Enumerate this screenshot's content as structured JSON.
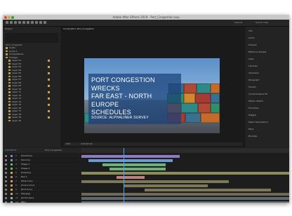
{
  "window": {
    "title": "Adobe After Effects 2019 - Port_Congestion.aep"
  },
  "toolbar": {
    "workspace_label": "Default",
    "search_label": "Search Help"
  },
  "project_panel": {
    "tab_label": "Project",
    "comp_name": "Port_Congestion",
    "items": [
      "Solids",
      "Comp 1",
      "Compositions",
      "Footage",
      "Layer 01",
      "Layer 02",
      "Layer 03",
      "Layer 04",
      "Layer 05",
      "Layer 06",
      "Layer 07",
      "Layer 08",
      "Layer 09",
      "Layer 10",
      "Layer 11",
      "Layer 12",
      "Layer 13",
      "Layer 14",
      "Layer 15",
      "Layer 16",
      "Layer 17",
      "Layer 18",
      "Layer 19",
      "Layer 20"
    ]
  },
  "composition": {
    "tab_label": "Composition Port_Congestion",
    "headline_line1": "PORT CONGESTION WRECKS",
    "headline_line2": "FAR EAST - NORTH EUROPE",
    "headline_line3": "SCHEDULES",
    "source": "SOURCE: ALPHALINER SURVEY",
    "zoom": "50%",
    "timecode": "0:00:04:12"
  },
  "right_panel": {
    "items": [
      "Info",
      "Audio",
      "Preview",
      "Effects & Presets",
      "Align",
      "Libraries",
      "Character",
      "Paragraph",
      "Tracker",
      "Content-Aware Fill",
      "Motion Sketch",
      "Smoother",
      "Wiggler",
      "Mask Interpolation",
      "Paint",
      "Brushes"
    ]
  },
  "timeline": {
    "tab_label": "Port_Congestion",
    "layers": [
      {
        "num": "1",
        "name": "[Headline]",
        "color": "#8f7bbd"
      },
      {
        "num": "2",
        "name": "[Source]",
        "color": "#6c9bd1"
      },
      {
        "num": "3",
        "name": "Shape 1",
        "color": "#6fb07a"
      },
      {
        "num": "4",
        "name": "Shape 2",
        "color": "#6fb07a"
      },
      {
        "num": "5",
        "name": "[Overlay]",
        "color": "#c8a34d"
      },
      {
        "num": "6",
        "name": "Null 1",
        "color": "#c17f7f"
      },
      {
        "num": "7",
        "name": "[Ship.mov]",
        "color": "#c8a34d"
      },
      {
        "num": "8",
        "name": "[Crane.mov]",
        "color": "#c8a34d"
      },
      {
        "num": "9",
        "name": "[Port.mov]",
        "color": "#c8a34d"
      },
      {
        "num": "10",
        "name": "[Sky.jpg]",
        "color": "#c8a34d"
      },
      {
        "num": "11",
        "name": "[Audio.wav]",
        "color": "#9fb0b8"
      },
      {
        "num": "12",
        "name": "[BG]",
        "color": "#9fb0b8"
      }
    ]
  },
  "colors": {
    "accent": "#4aa3ff",
    "overlay": "#184078"
  }
}
